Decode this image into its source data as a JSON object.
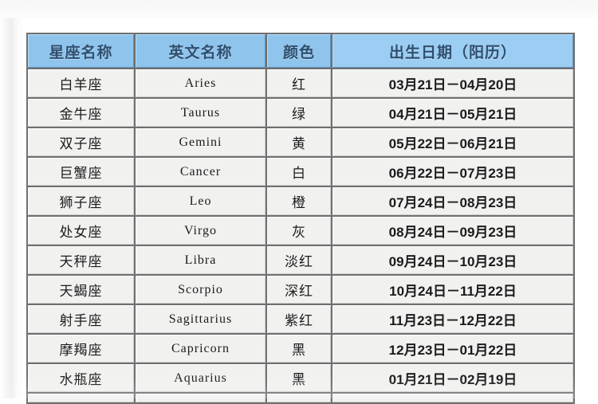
{
  "page": {
    "top_faint_text": "· · · · ·   · ·   · · · ·",
    "background_color": "#fbfcfb",
    "header_fill_color": "#8fc4ec",
    "header_text_color": "#2f4f6f",
    "cell_fill_color": "#f1f2f0",
    "cell_text_color": "#1b1b1b",
    "grid_line_color": "#6f6f6f"
  },
  "table": {
    "columns": [
      {
        "key": "name",
        "label": "星座名称"
      },
      {
        "key": "eng",
        "label": "英文名称"
      },
      {
        "key": "color",
        "label": "颜色"
      },
      {
        "key": "date",
        "label": "出生日期（阳历）"
      }
    ],
    "rows": [
      {
        "name": "白羊座",
        "eng": "Aries",
        "color": "红",
        "date": "03月21日－04月20日"
      },
      {
        "name": "金牛座",
        "eng": "Taurus",
        "color": "绿",
        "date": "04月21日－05月21日"
      },
      {
        "name": "双子座",
        "eng": "Gemini",
        "color": "黄",
        "date": "05月22日－06月21日"
      },
      {
        "name": "巨蟹座",
        "eng": "Cancer",
        "color": "白",
        "date": "06月22日－07月23日"
      },
      {
        "name": "狮子座",
        "eng": "Leo",
        "color": "橙",
        "date": "07月24日－08月23日"
      },
      {
        "name": "处女座",
        "eng": "Virgo",
        "color": "灰",
        "date": "08月24日－09月23日"
      },
      {
        "name": "天秤座",
        "eng": "Libra",
        "color": "淡红",
        "date": "09月24日－10月23日"
      },
      {
        "name": "天蝎座",
        "eng": "Scorpio",
        "color": "深红",
        "date": "10月24日－11月22日"
      },
      {
        "name": "射手座",
        "eng": "Sagittarius",
        "color": "紫红",
        "date": "11月23日－12月22日"
      },
      {
        "name": "摩羯座",
        "eng": "Capricorn",
        "color": "黑",
        "date": "12月23日－01月22日"
      },
      {
        "name": "水瓶座",
        "eng": "Aquarius",
        "color": "黑",
        "date": "01月21日－02月19日"
      }
    ]
  }
}
